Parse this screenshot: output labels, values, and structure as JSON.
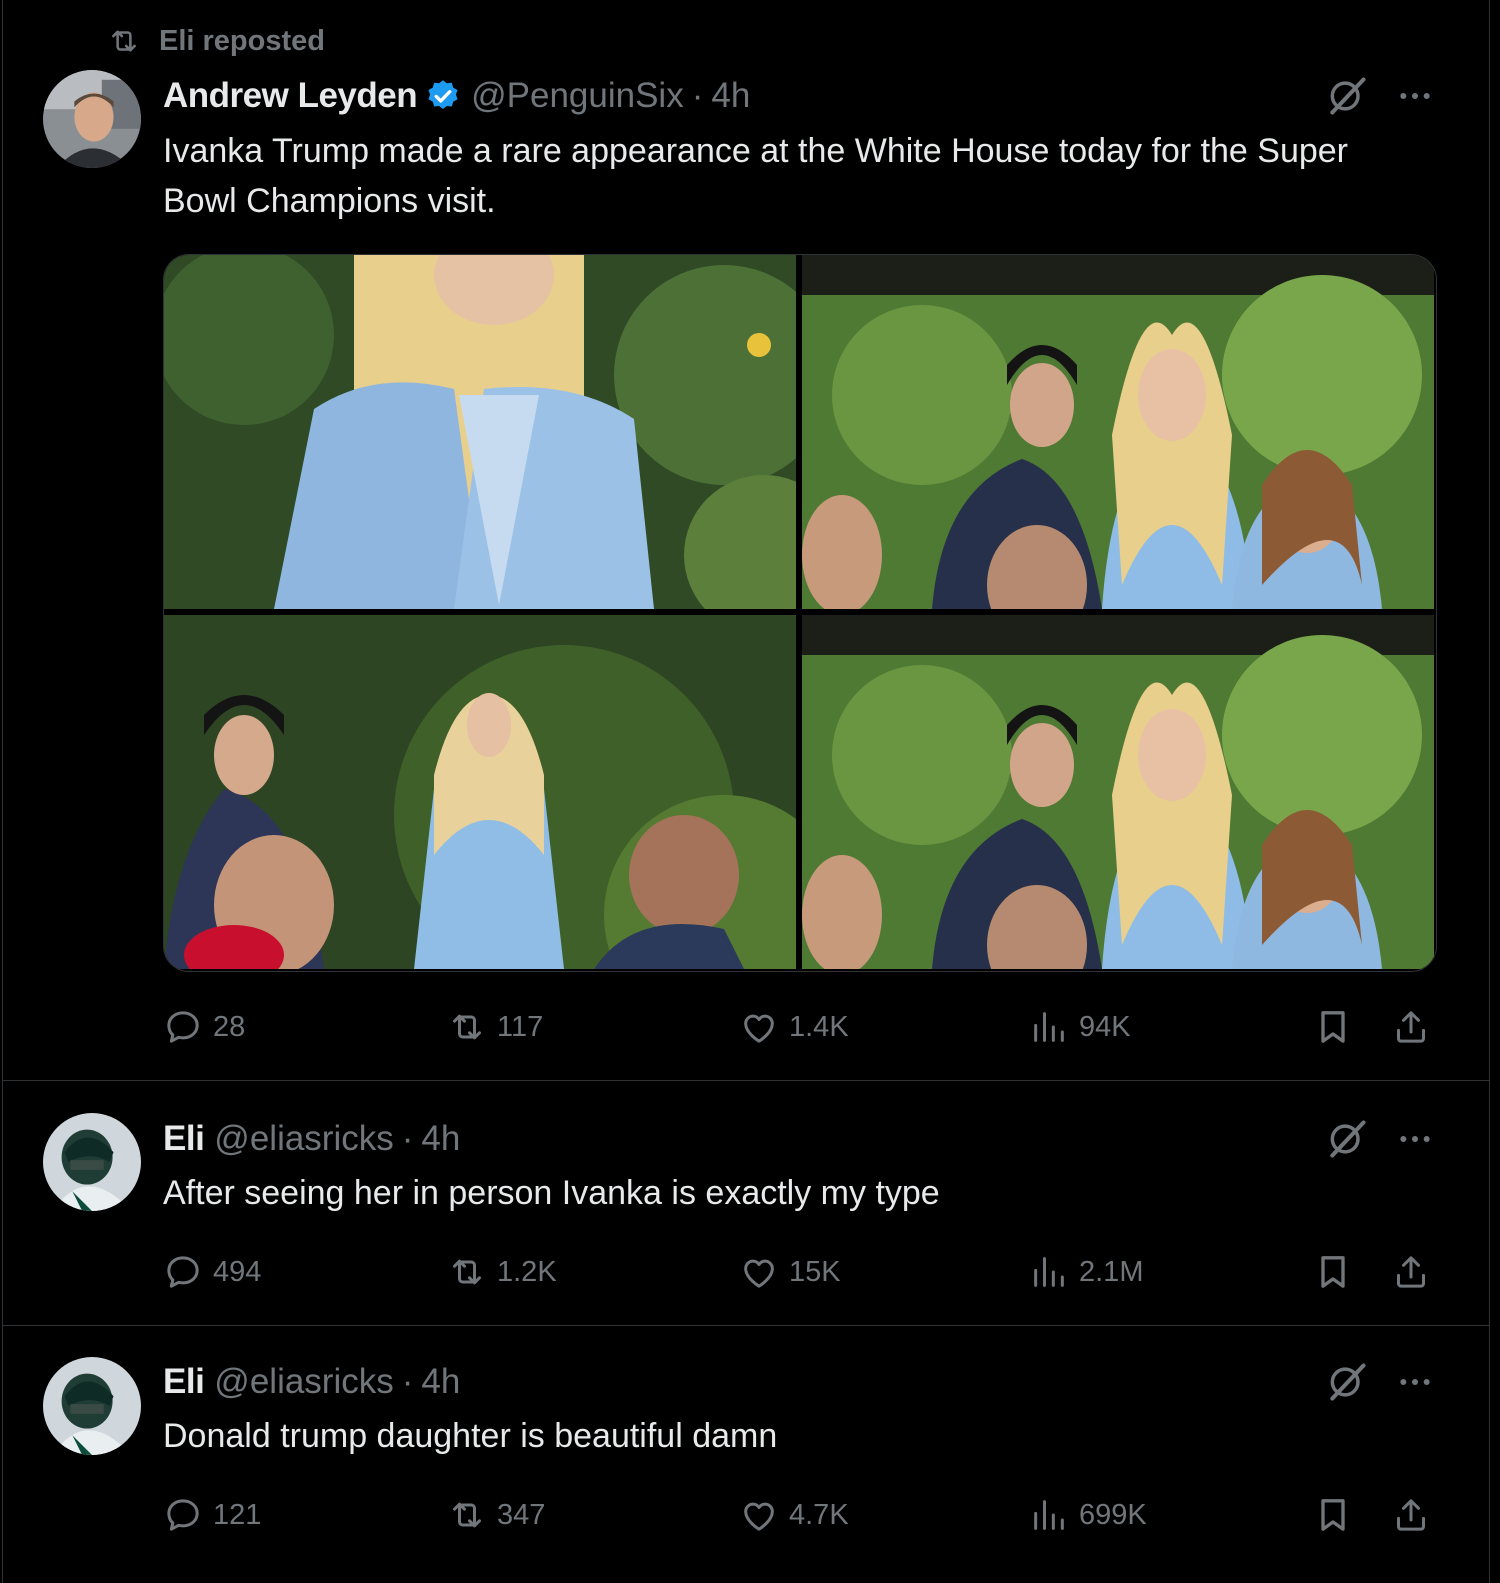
{
  "repost_banner": {
    "label": "Eli reposted"
  },
  "main_tweet": {
    "author_name": "Andrew Leyden",
    "handle": "@PenguinSix",
    "time": "4h",
    "text": "Ivanka Trump made a rare appearance at the White House today for the Super Bowl Champions visit.",
    "actions": {
      "replies": "28",
      "reposts": "117",
      "likes": "1.4K",
      "views": "94K"
    }
  },
  "replies": [
    {
      "author_name": "Eli",
      "handle": "@eliasricks",
      "time": "4h",
      "text": "After seeing her in person Ivanka is exactly my type",
      "actions": {
        "replies": "494",
        "reposts": "1.2K",
        "likes": "15K",
        "views": "2.1M"
      }
    },
    {
      "author_name": "Eli",
      "handle": "@eliasricks",
      "time": "4h",
      "text": "Donald trump daughter is beautiful damn",
      "actions": {
        "replies": "121",
        "reposts": "347",
        "likes": "4.7K",
        "views": "699K"
      }
    }
  ],
  "separator": "·",
  "colors": {
    "background": "#000000",
    "text": "#e7e9ea",
    "muted": "#71767b",
    "verified": "#1d9bf0",
    "divider": "#2f3336"
  },
  "icons": [
    "repost-icon",
    "verified-badge-icon",
    "grok-icon",
    "more-icon",
    "reply-icon",
    "like-icon",
    "views-icon",
    "bookmark-icon",
    "share-icon"
  ]
}
